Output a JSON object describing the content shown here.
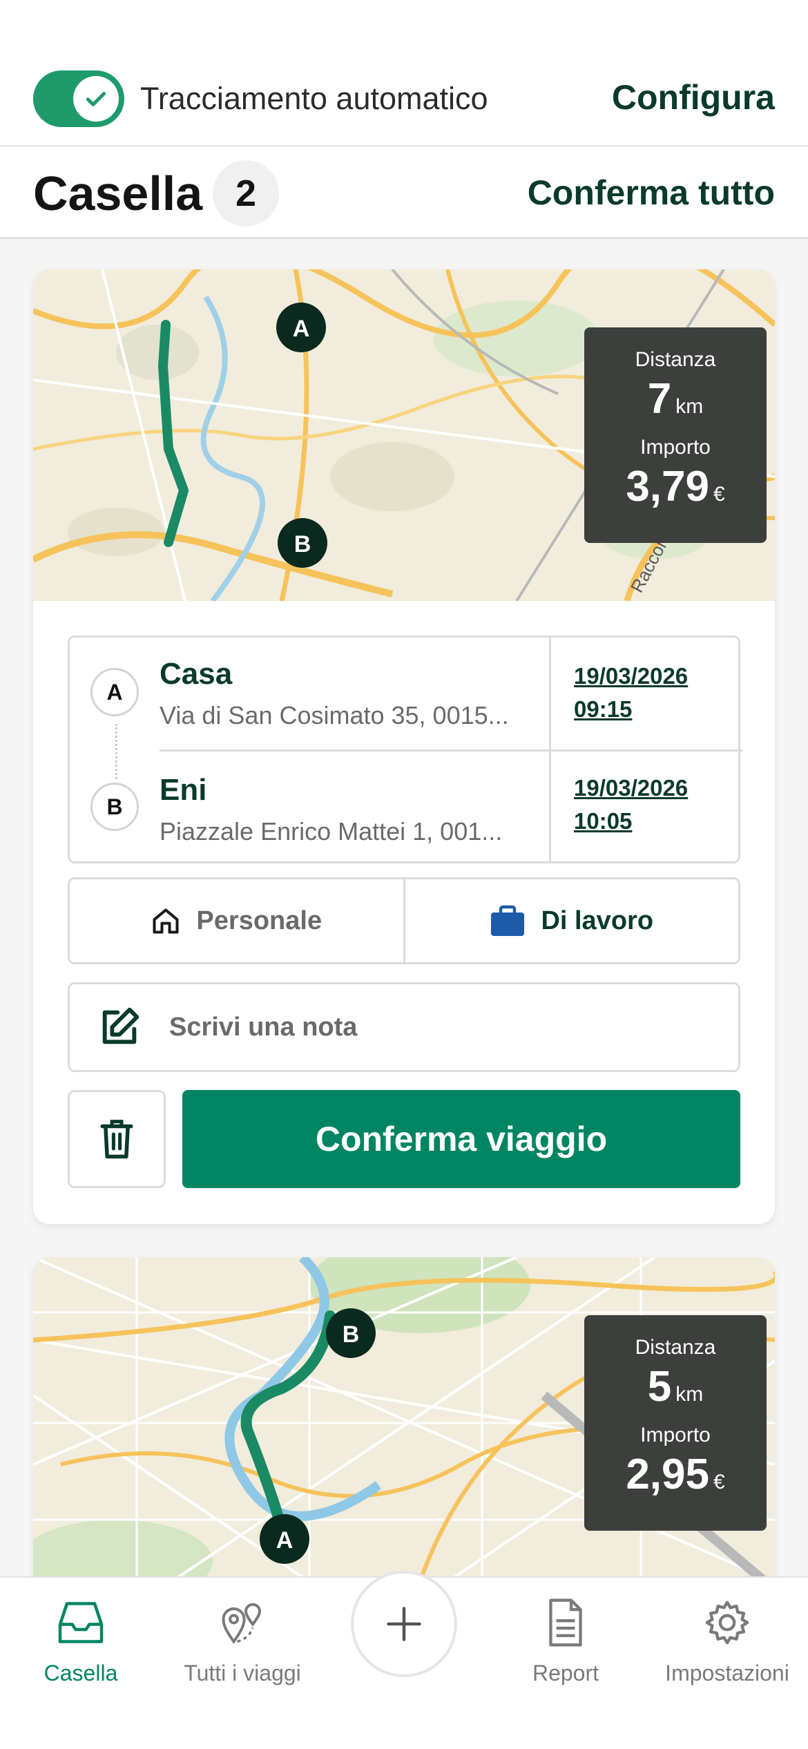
{
  "header": {
    "toggle_label": "Tracciamento automatico",
    "toggle_on": true,
    "configure_label": "Configura"
  },
  "inbox": {
    "title": "Casella",
    "count": "2",
    "confirm_all_label": "Conferma tutto"
  },
  "trips": [
    {
      "distance_label": "Distanza",
      "distance_value": "7",
      "distance_unit": "km",
      "amount_label": "Importo",
      "amount_value": "3,79",
      "amount_unit": "€",
      "map_road_label": "Raccordo",
      "start": {
        "pin": "A",
        "name": "Casa",
        "address": "Via di San Cosimato 35, 0015...",
        "date": "19/03/2026",
        "time": "09:15"
      },
      "end": {
        "pin": "B",
        "name": "Eni",
        "address": "Piazzale Enrico Mattei 1, 001...",
        "date": "19/03/2026",
        "time": "10:05"
      },
      "type_personal_label": "Personale",
      "type_work_label": "Di lavoro",
      "note_placeholder": "Scrivi una nota",
      "confirm_label": "Conferma viaggio"
    },
    {
      "distance_label": "Distanza",
      "distance_value": "5",
      "distance_unit": "km",
      "amount_label": "Importo",
      "amount_value": "2,95",
      "amount_unit": "€",
      "start_pin": "A",
      "end_pin": "B"
    }
  ],
  "tabbar": {
    "inbox_label": "Casella",
    "trips_label": "Tutti i viaggi",
    "report_label": "Report",
    "settings_label": "Impostazioni"
  },
  "colors": {
    "accent": "#008563",
    "dark_green": "#0a3a2a",
    "route": "#1a8a64",
    "stats_bg": "#3d3f3d"
  }
}
